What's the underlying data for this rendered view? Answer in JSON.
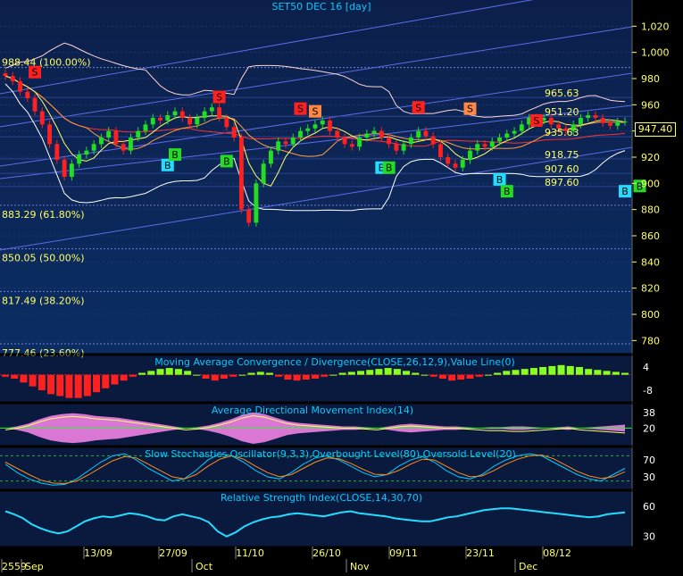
{
  "colors": {
    "main_bg_top": "#0c1f4a",
    "main_bg_bottom": "#0b2d63",
    "panel_bg": "#0a1a3e",
    "axis_bg": "#000000",
    "axis_text": "#ffff66",
    "title_text": "#00ccff",
    "grid": "#1c3a6e",
    "fib_line": "#6f7fd8",
    "price_tag_bg": "#000000",
    "price_tag_fg": "#ffff66",
    "macd_pos": "#88ff22",
    "macd_neg": "#ff2020",
    "adx_pink": "#ff88ee",
    "adx_green": "#33ee33",
    "stoch_k": "#00ccff",
    "stoch_d": "#ff8c1a",
    "rsi": "#22ddff",
    "buy_cyan": "#22ddff",
    "buy_green": "#22dd22",
    "sell_red": "#ff2020",
    "sell_orange": "#ff8844"
  },
  "chart_data": [
    {
      "id": "price",
      "type": "candlestick",
      "title": "SET50 DEC 16   [day]",
      "last_price_label": "947.40",
      "ylim": [
        770,
        1040
      ],
      "yticks": [
        "1,020",
        "1,000",
        "980",
        "960",
        "940",
        "920",
        "900",
        "880",
        "860",
        "840",
        "820",
        "800",
        "780"
      ],
      "ytick_values": [
        1020,
        1000,
        980,
        960,
        940,
        920,
        900,
        880,
        860,
        840,
        820,
        800,
        780
      ],
      "fib_levels": [
        {
          "label": "988.44 (100.00%)",
          "value": 988.44
        },
        {
          "label": "883.29 (61.80%)",
          "value": 883.29
        },
        {
          "label": "850.05 (50.00%)",
          "value": 850.05
        },
        {
          "label": "817.49 (38.20%)",
          "value": 817.49
        },
        {
          "label": "777.46 (23.60%)",
          "value": 777.46
        }
      ],
      "level_labels": [
        {
          "label": "965.63",
          "value": 965.63
        },
        {
          "label": "951.20",
          "value": 951.2
        },
        {
          "label": "935.63",
          "value": 935.63
        },
        {
          "label": "918.75",
          "value": 918.75
        },
        {
          "label": "907.60",
          "value": 907.6
        },
        {
          "label": "897.60",
          "value": 897.6
        }
      ],
      "closes": [
        982,
        978,
        970,
        965,
        955,
        945,
        930,
        918,
        905,
        915,
        922,
        925,
        930,
        935,
        940,
        930,
        925,
        935,
        940,
        945,
        950,
        948,
        952,
        955,
        950,
        945,
        950,
        955,
        958,
        950,
        943,
        935,
        880,
        870,
        900,
        915,
        925,
        932,
        930,
        935,
        940,
        942,
        945,
        948,
        940,
        935,
        930,
        928,
        935,
        938,
        940,
        935,
        930,
        925,
        930,
        935,
        940,
        936,
        930,
        920,
        915,
        912,
        918,
        925,
        930,
        928,
        932,
        935,
        938,
        940,
        945,
        950,
        948,
        950,
        945,
        942,
        940,
        945,
        950,
        952,
        950,
        946,
        944,
        947,
        947.4
      ],
      "signals": [
        {
          "text": "S",
          "x": 4,
          "value": 985,
          "color": "sell_red"
        },
        {
          "text": "B",
          "x": 22,
          "value": 914,
          "color": "buy_cyan"
        },
        {
          "text": "B",
          "x": 23,
          "value": 922,
          "color": "buy_green"
        },
        {
          "text": "S",
          "x": 29,
          "value": 966,
          "color": "sell_red"
        },
        {
          "text": "B",
          "x": 30,
          "value": 917,
          "color": "buy_green"
        },
        {
          "text": "S",
          "x": 40,
          "value": 957,
          "color": "sell_red"
        },
        {
          "text": "S",
          "x": 42,
          "value": 955,
          "color": "sell_orange"
        },
        {
          "text": "B",
          "x": 51,
          "value": 912,
          "color": "buy_cyan"
        },
        {
          "text": "B",
          "x": 52,
          "value": 912,
          "color": "buy_green"
        },
        {
          "text": "S",
          "x": 56,
          "value": 958,
          "color": "sell_red"
        },
        {
          "text": "S",
          "x": 63,
          "value": 957,
          "color": "sell_orange"
        },
        {
          "text": "B",
          "x": 67,
          "value": 903,
          "color": "buy_cyan"
        },
        {
          "text": "B",
          "x": 68,
          "value": 894,
          "color": "buy_green"
        },
        {
          "text": "S",
          "x": 72,
          "value": 948,
          "color": "sell_red"
        },
        {
          "text": "B",
          "x": 84,
          "value": 894,
          "color": "buy_cyan"
        },
        {
          "text": "B",
          "x": 86,
          "value": 898,
          "color": "buy_green"
        },
        {
          "text": "S",
          "x": 106,
          "value": 965,
          "color": "sell_orange"
        }
      ]
    },
    {
      "id": "macd",
      "type": "bar",
      "title": "Moving Average Convergence / Divergence(CLOSE,26,12,9),Value Line(0)",
      "yticks": [
        "4",
        "-8"
      ],
      "ytick_values": [
        4,
        -8
      ],
      "ylim": [
        -14,
        10
      ],
      "values": [
        -1,
        -2,
        -4,
        -6,
        -8,
        -10,
        -11,
        -12,
        -12,
        -11,
        -9,
        -7,
        -5,
        -3,
        -1,
        1,
        2,
        3,
        3.5,
        3,
        2,
        0,
        -2,
        -3,
        -2,
        -1,
        0,
        1,
        1.5,
        1,
        -1,
        -2.5,
        -3,
        -2.5,
        -2,
        -1,
        0,
        1,
        1.5,
        2,
        2.5,
        3,
        3.5,
        3,
        2,
        1,
        0,
        -1,
        -2,
        -3,
        -2.5,
        -2,
        -1,
        0,
        1,
        2,
        2.5,
        3,
        3.5,
        4,
        4.5,
        5,
        4.5,
        4,
        3,
        2.5,
        2,
        1.5,
        1
      ]
    },
    {
      "id": "adx",
      "type": "area",
      "title": "Average Directional Movement Index(14)",
      "yticks": [
        "38",
        "20"
      ],
      "ytick_values": [
        38,
        20
      ],
      "ylim": [
        0,
        48
      ],
      "values": [
        20,
        22,
        25,
        30,
        34,
        36,
        37,
        36,
        34,
        33,
        32,
        30,
        28,
        26,
        24,
        22,
        20,
        21,
        23,
        26,
        30,
        35,
        38,
        36,
        32,
        28,
        26,
        25,
        24,
        23,
        22,
        22,
        21,
        20,
        22,
        24,
        25,
        24,
        23,
        22,
        22,
        21,
        20,
        19,
        19,
        18,
        18,
        19,
        20,
        21,
        22,
        20,
        19,
        18,
        17,
        16
      ]
    },
    {
      "id": "stoch",
      "type": "line",
      "title": "Slow Stochastics Oscillator(9,3,3),Overbought Level(80),Oversold Level(20)",
      "yticks": [
        "70",
        "30"
      ],
      "ytick_values": [
        70,
        30
      ],
      "ylim": [
        0,
        100
      ],
      "series": [
        {
          "name": "%K",
          "values": [
            60,
            40,
            25,
            15,
            10,
            12,
            25,
            45,
            65,
            80,
            85,
            70,
            50,
            35,
            20,
            25,
            45,
            70,
            85,
            80,
            65,
            45,
            30,
            25,
            40,
            60,
            75,
            80,
            70,
            55,
            40,
            30,
            35,
            55,
            70,
            78,
            65,
            45,
            30,
            25,
            35,
            55,
            70,
            80,
            85,
            80,
            65,
            50,
            35,
            25,
            20,
            35,
            50
          ]
        },
        {
          "name": "%D",
          "values": [
            65,
            50,
            35,
            22,
            15,
            14,
            20,
            35,
            52,
            68,
            78,
            75,
            60,
            45,
            30,
            25,
            35,
            55,
            72,
            80,
            72,
            55,
            40,
            30,
            35,
            50,
            65,
            75,
            73,
            62,
            48,
            36,
            35,
            45,
            60,
            72,
            70,
            55,
            40,
            30,
            32,
            45,
            60,
            72,
            80,
            82,
            73,
            58,
            43,
            32,
            26,
            30,
            42
          ]
        }
      ]
    },
    {
      "id": "rsi",
      "type": "line",
      "title": "Relative Strength Index(CLOSE,14,30,70)",
      "yticks": [
        "60",
        "30"
      ],
      "ytick_values": [
        60,
        30
      ],
      "ylim": [
        20,
        75
      ],
      "values": [
        55,
        52,
        48,
        42,
        38,
        35,
        33,
        35,
        40,
        45,
        48,
        50,
        49,
        51,
        53,
        52,
        50,
        47,
        46,
        50,
        52,
        50,
        48,
        44,
        35,
        30,
        34,
        40,
        44,
        47,
        49,
        50,
        52,
        53,
        52,
        51,
        50,
        52,
        54,
        55,
        53,
        52,
        51,
        50,
        48,
        47,
        46,
        45,
        45,
        47,
        49,
        50,
        52,
        54,
        56,
        57,
        58,
        58,
        57,
        56,
        55,
        54,
        53,
        52,
        51,
        50,
        49,
        50,
        52,
        53,
        54
      ]
    }
  ],
  "xaxis": {
    "day_labels": [
      "13/09",
      "27/09",
      "11/10",
      "26/10",
      "09/11",
      "23/11",
      "08/12"
    ],
    "month_labels": [
      "2559",
      "Sep",
      "Oct",
      "Nov",
      "Dec"
    ]
  }
}
